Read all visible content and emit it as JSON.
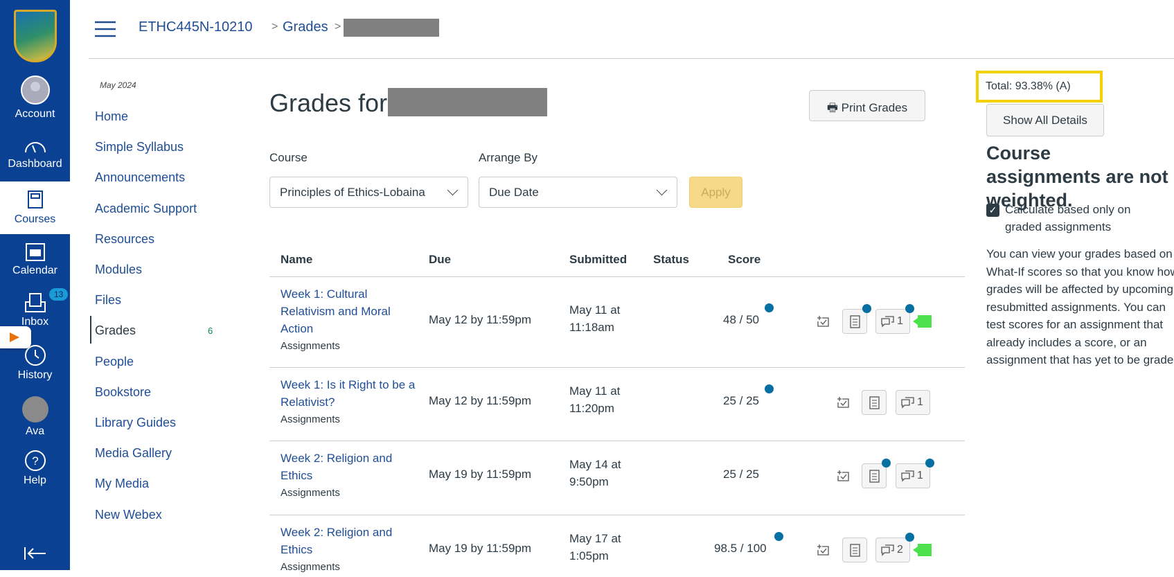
{
  "global_nav": {
    "items": [
      {
        "label": "Account",
        "icon": "account-icon"
      },
      {
        "label": "Dashboard",
        "icon": "dashboard-icon"
      },
      {
        "label": "Courses",
        "icon": "courses-icon"
      },
      {
        "label": "Calendar",
        "icon": "calendar-icon"
      },
      {
        "label": "Inbox",
        "icon": "inbox-icon",
        "badge": "13"
      },
      {
        "label": "History",
        "icon": "history-icon"
      },
      {
        "label": "Ava",
        "icon": "avatar"
      },
      {
        "label": "Help",
        "icon": "help-icon"
      }
    ]
  },
  "breadcrumb": {
    "course": "ETHC445N-10210",
    "page": "Grades"
  },
  "course_nav": {
    "term": "May 2024",
    "items": [
      {
        "label": "Home"
      },
      {
        "label": "Simple Syllabus"
      },
      {
        "label": "Announcements"
      },
      {
        "label": "Academic Support"
      },
      {
        "label": "Resources"
      },
      {
        "label": "Modules"
      },
      {
        "label": "Files"
      },
      {
        "label": "Grades",
        "badge": "6",
        "active": true
      },
      {
        "label": "People"
      },
      {
        "label": "Bookstore"
      },
      {
        "label": "Library Guides"
      },
      {
        "label": "Media Gallery"
      },
      {
        "label": "My Media"
      },
      {
        "label": "New Webex"
      }
    ]
  },
  "main": {
    "title": "Grades for",
    "print_label": "Print Grades",
    "course_label": "Course",
    "course_value": "Principles of Ethics-Lobaina",
    "arrange_label": "Arrange By",
    "arrange_value": "Due Date",
    "apply_label": "Apply",
    "columns": [
      "Name",
      "Due",
      "Submitted",
      "Status",
      "Score"
    ],
    "rows": [
      {
        "name": "Week 1: Cultural Relativism and Moral Action",
        "group": "Assignments",
        "due": "May 12 by 11:59pm",
        "submitted": "May 11 at 11:18am",
        "score": "48 / 50",
        "comments": "1"
      },
      {
        "name": "Week 1: Is it Right to be a Relativist?",
        "group": "Assignments",
        "due": "May 12 by 11:59pm",
        "submitted": "May 11 at 11:20pm",
        "score": "25 / 25",
        "comments": "1"
      },
      {
        "name": "Week 2: Religion and Ethics",
        "group": "Assignments",
        "due": "May 19 by 11:59pm",
        "submitted": "May 14 at 9:50pm",
        "score": "25 / 25",
        "comments": "1"
      },
      {
        "name": "Week 2: Religion and Ethics",
        "group": "Assignments",
        "due": "May 19 by 11:59pm",
        "submitted": "May 17 at 1:05pm",
        "score": "98.5 / 100",
        "comments": "2"
      }
    ]
  },
  "sidebar": {
    "total": "Total: 93.38% (A)",
    "show_all": "Show All Details",
    "heading": "Course assignments are not weighted.",
    "checkbox_label": "Calculate based only on graded assignments",
    "checkbox_checked": true,
    "info": "You can view your grades based on What-If scores so that you know how grades will be affected by upcoming or resubmitted assignments. You can test scores for an assignment that already includes a score, or an assignment that has yet to be graded."
  },
  "colors": {
    "nav": "#0b4193",
    "link": "#1f4e96",
    "highlight": "#f5d000",
    "unread": "#0770a3"
  }
}
